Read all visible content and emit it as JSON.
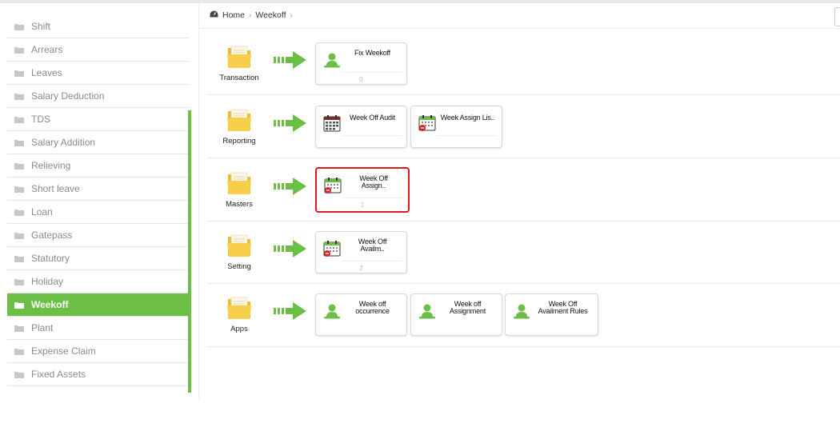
{
  "sidebar": {
    "items": [
      {
        "label": "Shift"
      },
      {
        "label": "Arrears"
      },
      {
        "label": "Leaves"
      },
      {
        "label": "Salary Deduction"
      },
      {
        "label": "TDS"
      },
      {
        "label": "Salary Addition"
      },
      {
        "label": "Relieving"
      },
      {
        "label": "Short leave"
      },
      {
        "label": "Loan"
      },
      {
        "label": "Gatepass"
      },
      {
        "label": "Statutory"
      },
      {
        "label": "Holiday"
      },
      {
        "label": "Weekoff",
        "active": true
      },
      {
        "label": "Plant"
      },
      {
        "label": "Expense Claim"
      },
      {
        "label": "Fixed Assets"
      }
    ]
  },
  "breadcrumb": {
    "home": "Home",
    "current": "Weekoff"
  },
  "rows": {
    "transaction": {
      "label": "Transaction",
      "cards": [
        {
          "title": "Fix Weekoff",
          "count": "0",
          "icon": "person-icon"
        }
      ]
    },
    "reporting": {
      "label": "Reporting",
      "cards": [
        {
          "title": "Week Off Audit",
          "count": "",
          "icon": "calendar-grid-icon"
        },
        {
          "title": "Week Assign Lis..",
          "count": "",
          "icon": "calendar-alert-icon"
        }
      ]
    },
    "masters": {
      "label": "Masters",
      "cards": [
        {
          "title_line1": "Week Off",
          "title_line2": "Assign..",
          "count": "1",
          "icon": "calendar-alert-icon"
        }
      ]
    },
    "setting": {
      "label": "Setting",
      "cards": [
        {
          "title_line1": "Week Off",
          "title_line2": "Availm..",
          "count": "2",
          "icon": "calendar-alert-icon"
        }
      ]
    },
    "apps": {
      "label": "Apps",
      "cards": [
        {
          "title_line1": "Week off",
          "title_line2": "occurrence",
          "icon": "person-icon"
        },
        {
          "title_line1": "Week off",
          "title_line2": "Assignment",
          "icon": "person-icon"
        },
        {
          "title_line1": "Week Off",
          "title_line2": "Availment Rules",
          "icon": "person-icon"
        }
      ]
    }
  },
  "colors": {
    "accent": "#6cbf45",
    "selected": "#e3161d",
    "folder": "#f5c842"
  }
}
